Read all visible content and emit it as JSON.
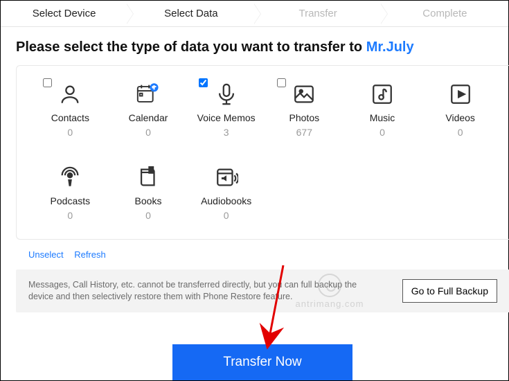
{
  "steps": [
    "Select Device",
    "Select Data",
    "Transfer",
    "Complete"
  ],
  "activeStep": 1,
  "prompt": {
    "text": "Please select the type of data you want to transfer to ",
    "device": "Mr.July"
  },
  "tiles": [
    {
      "id": "contacts",
      "label": "Contacts",
      "count": "0",
      "checked": false,
      "showCheckbox": true
    },
    {
      "id": "calendar",
      "label": "Calendar",
      "count": "0",
      "checked": false,
      "showCheckbox": false
    },
    {
      "id": "voicememos",
      "label": "Voice Memos",
      "count": "3",
      "checked": true,
      "showCheckbox": true
    },
    {
      "id": "photos",
      "label": "Photos",
      "count": "677",
      "checked": false,
      "showCheckbox": true
    },
    {
      "id": "music",
      "label": "Music",
      "count": "0",
      "checked": false,
      "showCheckbox": false
    },
    {
      "id": "videos",
      "label": "Videos",
      "count": "0",
      "checked": false,
      "showCheckbox": false
    },
    {
      "id": "podcasts",
      "label": "Podcasts",
      "count": "0",
      "checked": false,
      "showCheckbox": false
    },
    {
      "id": "books",
      "label": "Books",
      "count": "0",
      "checked": false,
      "showCheckbox": false
    },
    {
      "id": "audiobooks",
      "label": "Audiobooks",
      "count": "0",
      "checked": false,
      "showCheckbox": false
    }
  ],
  "links": {
    "unselect": "Unselect",
    "refresh": "Refresh"
  },
  "notice": {
    "message": "Messages, Call History, etc. cannot be transferred directly, but you can full backup the device and then selectively restore them with Phone Restore feature.",
    "button": "Go to Full Backup"
  },
  "primary": "Transfer Now",
  "watermark": "antrimang.com"
}
